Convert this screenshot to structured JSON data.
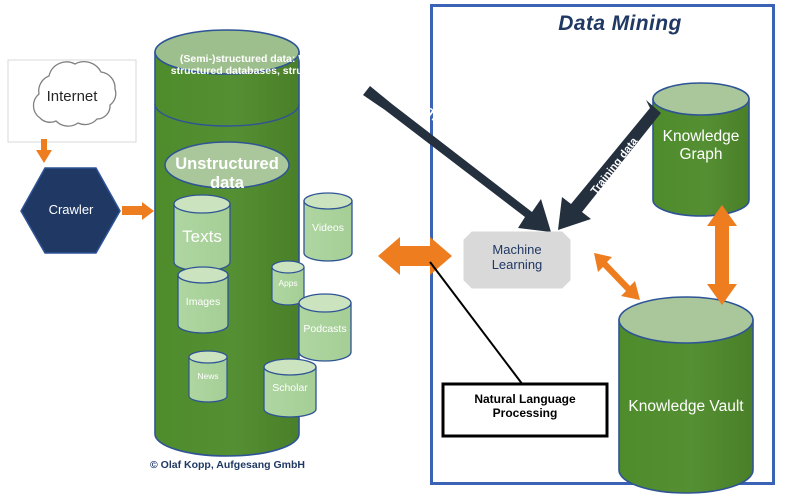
{
  "diagram": {
    "title": "Data Mining",
    "credit": "© Olaf Kopp, Aufgesang GmbH"
  },
  "colors": {
    "green_body": "#4F8A2E",
    "green_top": "#A9C79A",
    "light_green_body": "#AED5A0",
    "light_green_top": "#C9E3BC",
    "outline_blue": "#2E5496",
    "navy": "#1F3864",
    "navy_arrow": "#25303F",
    "orange": "#ED7D1F",
    "gray_box": "#D9D9D9",
    "white": "#FFFFFF",
    "frame_blue": "#3B63B5"
  },
  "source": {
    "internet_label": "Internet",
    "crawler_label": "Crawler"
  },
  "data_store": {
    "structured_caption": "(Semi-)structured data: Wikipedia,\nstructured databases, structured data",
    "unstructured_caption": "Unstructured data",
    "content_types": [
      {
        "label": "Texts"
      },
      {
        "label": "Videos"
      },
      {
        "label": "Images"
      },
      {
        "label": "Apps"
      },
      {
        "label": "Podcasts"
      },
      {
        "label": "News"
      },
      {
        "label": "Scholar"
      }
    ]
  },
  "mining": {
    "ml_label": "Machine\nLearning",
    "nlp_label": "Natural Language\nProcessing",
    "knowledge_graph_label": "Knowledge\nGraph",
    "knowledge_vault_label": "Knowledge Vault",
    "training_arrow_left": "Training data",
    "training_arrow_right": "Training data"
  }
}
